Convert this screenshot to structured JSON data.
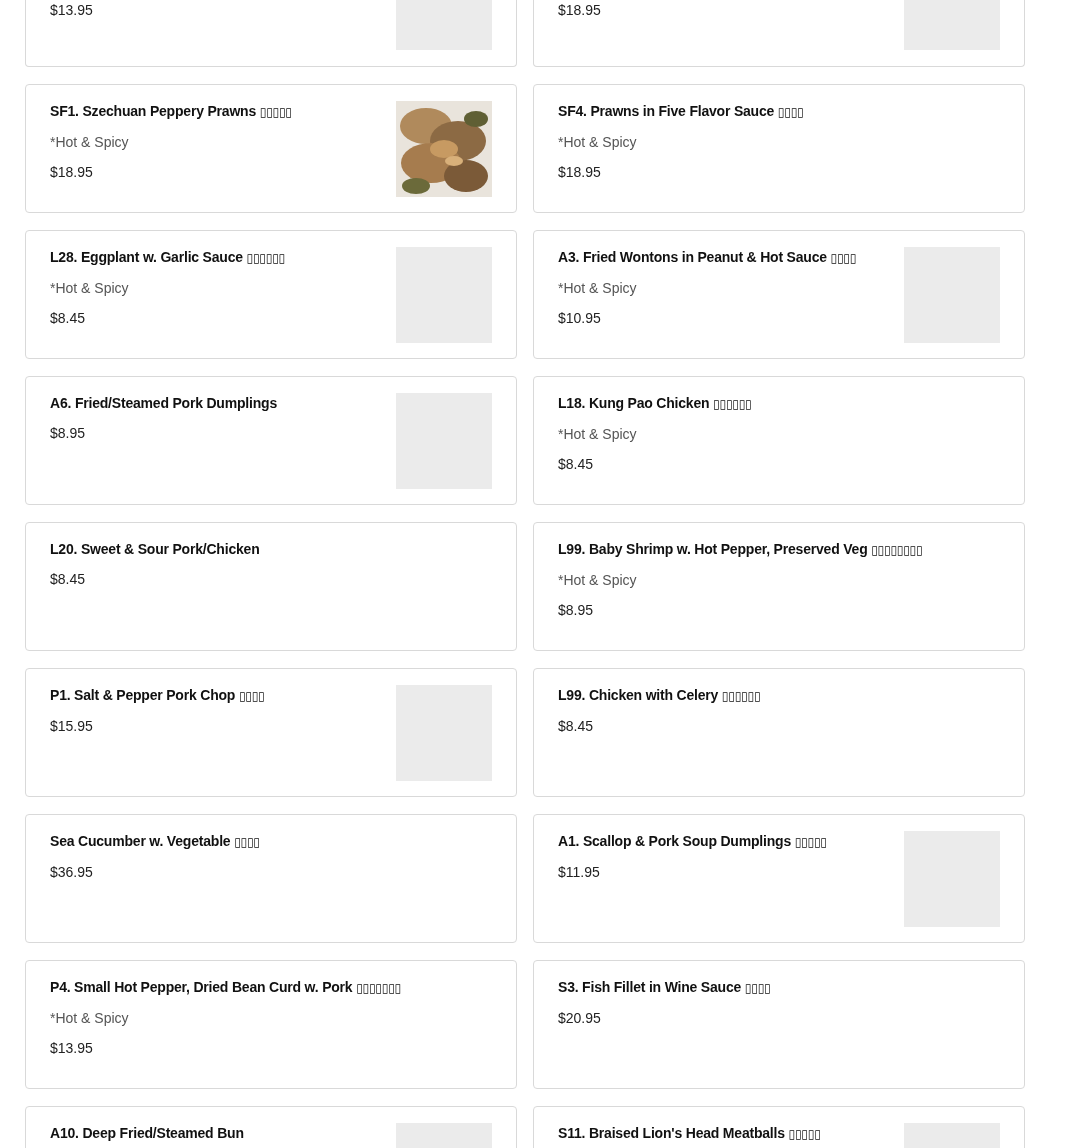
{
  "menu_items": [
    {
      "cut_off": true,
      "price": "$13.95",
      "kind": "placeholder"
    },
    {
      "cut_off": true,
      "price": "$18.95",
      "kind": "placeholder"
    },
    {
      "name": "SF1. Szechuan Peppery Prawns",
      "glyphs": "▯▯▯▯▯",
      "note": "*Hot & Spicy",
      "price": "$18.95",
      "kind": "picture"
    },
    {
      "name": "SF4. Prawns in Five Flavor Sauce",
      "glyphs": "▯▯▯▯",
      "note": "*Hot & Spicy",
      "price": "$18.95"
    },
    {
      "name": "L28. Eggplant w. Garlic Sauce",
      "glyphs": "▯▯▯▯▯▯",
      "note": "*Hot & Spicy",
      "price": "$8.45",
      "kind": "placeholder"
    },
    {
      "name": "A3. Fried Wontons in Peanut & Hot Sauce",
      "glyphs": "▯▯▯▯",
      "note": "*Hot & Spicy",
      "price": "$10.95",
      "kind": "placeholder"
    },
    {
      "name": "A6. Fried/Steamed Pork Dumplings",
      "price": "$8.95",
      "kind": "placeholder"
    },
    {
      "name": "L18. Kung Pao Chicken",
      "glyphs": "▯▯▯▯▯▯",
      "note": "*Hot & Spicy",
      "price": "$8.45"
    },
    {
      "name": "L20. Sweet & Sour Pork/Chicken",
      "price": "$8.45"
    },
    {
      "name": "L99. Baby Shrimp w. Hot Pepper, Preserved Veg",
      "glyphs": "▯▯▯▯▯▯▯▯",
      "note": "*Hot & Spicy",
      "price": "$8.95"
    },
    {
      "name": "P1. Salt & Pepper Pork Chop",
      "glyphs": "▯▯▯▯",
      "price": "$15.95",
      "kind": "placeholder"
    },
    {
      "name": "L99. Chicken with Celery",
      "glyphs": "▯▯▯▯▯▯",
      "price": "$8.45"
    },
    {
      "name": "Sea Cucumber w. Vegetable",
      "glyphs": "▯▯▯▯",
      "price": "$36.95"
    },
    {
      "name": "A1. Scallop & Pork Soup Dumplings",
      "glyphs": "▯▯▯▯▯",
      "price": "$11.95",
      "kind": "placeholder"
    },
    {
      "name": "P4. Small Hot Pepper, Dried Bean Curd w. Pork",
      "glyphs": "▯▯▯▯▯▯▯",
      "note": "*Hot & Spicy",
      "price": "$13.95"
    },
    {
      "name": "S3. Fish Fillet in Wine Sauce",
      "glyphs": "▯▯▯▯",
      "price": "$20.95"
    },
    {
      "name": "A10. Deep Fried/Steamed Bun",
      "kind": "placeholder"
    },
    {
      "name": "S11. Braised Lion's Head Meatballs",
      "glyphs": "▯▯▯▯▯",
      "kind": "placeholder"
    }
  ]
}
